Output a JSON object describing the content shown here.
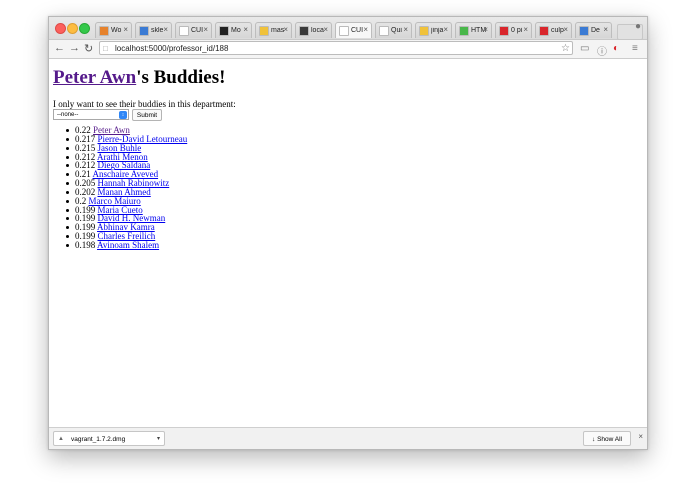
{
  "browser": {
    "tabs": [
      {
        "title": "Wo",
        "favicon": "#e6822c",
        "active": false
      },
      {
        "title": "skle",
        "favicon": "#3b7bd4",
        "active": false
      },
      {
        "title": "CUI",
        "favicon": "#ffffff",
        "active": false
      },
      {
        "title": "Mo",
        "favicon": "#222222",
        "active": false
      },
      {
        "title": "mas",
        "favicon": "#f0c23a",
        "active": false
      },
      {
        "title": "loca",
        "favicon": "#3a3a3a",
        "active": false
      },
      {
        "title": "CUI",
        "favicon": "#ffffff",
        "active": true
      },
      {
        "title": "Qui",
        "favicon": "#ffffff",
        "active": false
      },
      {
        "title": "jinja",
        "favicon": "#f0c23a",
        "active": false
      },
      {
        "title": "HTM",
        "favicon": "#49b74a",
        "active": false
      },
      {
        "title": "0 pi",
        "favicon": "#d9262c",
        "active": false
      },
      {
        "title": "culp",
        "favicon": "#d9262c",
        "active": false
      },
      {
        "title": "De",
        "favicon": "#3b7bd4",
        "active": false
      }
    ],
    "url": "localhost:5000/professor_id/188",
    "icons": {
      "back": "back-arrow-icon",
      "forward": "forward-arrow-icon",
      "reload": "reload-icon",
      "bookmark": "star-icon",
      "cast": "cast-icon",
      "info": "info-icon",
      "extension": "extension-icon",
      "menu": "hamburger-menu-icon",
      "user": "user-icon"
    }
  },
  "page": {
    "professor": "Peter Awn",
    "title_suffix": "'s Buddies!",
    "filter_text": "I only want to see their buddies in this department:",
    "select_value": "--none--",
    "submit_label": "Submit",
    "buddies": [
      {
        "score": "0.22",
        "name": "Peter Awn",
        "visited": true
      },
      {
        "score": "0.217",
        "name": "Pierre-David Letourneau",
        "visited": false
      },
      {
        "score": "0.215",
        "name": "Jason Buhle",
        "visited": false
      },
      {
        "score": "0.212",
        "name": "Arathi Menon",
        "visited": false
      },
      {
        "score": "0.212",
        "name": "Diego Saldana",
        "visited": false
      },
      {
        "score": "0.21",
        "name": "Anschaire Aveved",
        "visited": false
      },
      {
        "score": "0.205",
        "name": "Hannah Rabinowitz",
        "visited": false
      },
      {
        "score": "0.202",
        "name": "Manan Ahmed",
        "visited": false
      },
      {
        "score": "0.2",
        "name": "Marco Maiuro",
        "visited": false
      },
      {
        "score": "0.199",
        "name": "Maria Cueto",
        "visited": false
      },
      {
        "score": "0.199",
        "name": "David H. Newman",
        "visited": false
      },
      {
        "score": "0.199",
        "name": "Abhinav Kamra",
        "visited": false
      },
      {
        "score": "0.199",
        "name": "Charles Freilich",
        "visited": false
      },
      {
        "score": "0.198",
        "name": "Avinoam Shalem",
        "visited": false
      }
    ]
  },
  "downloads": {
    "filename": "vagrant_1.7.2.dmg",
    "show_all_label": "Show All"
  }
}
